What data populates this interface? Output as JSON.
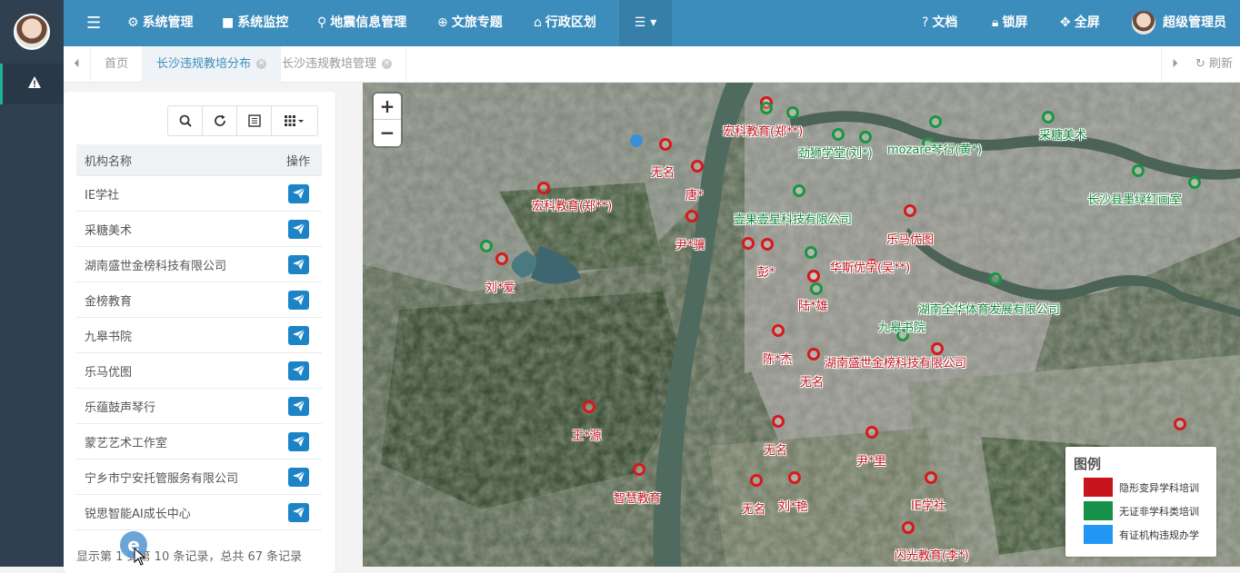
{
  "sidebar": {
    "avatar_alt": "avatar",
    "alert_icon": "warning-icon"
  },
  "navbar": {
    "menu_icon": "hamburger-icon",
    "items": [
      {
        "label": "系统管理",
        "icon": "gear-icon"
      },
      {
        "label": "系统监控",
        "icon": "video-icon"
      },
      {
        "label": "地震信息管理",
        "icon": "map-marker-icon"
      },
      {
        "label": "文旅专题",
        "icon": "globe-icon"
      },
      {
        "label": "行政区划",
        "icon": "bank-icon"
      }
    ],
    "more_icon": "list-dropdown-icon",
    "right": [
      {
        "label": "文档",
        "icon": "question-icon"
      },
      {
        "label": "锁屏",
        "icon": "lock-icon"
      },
      {
        "label": "全屏",
        "icon": "fullscreen-icon"
      }
    ],
    "user_name": "超级管理员"
  },
  "tabs": {
    "items": [
      {
        "label": "首页"
      },
      {
        "label": "长沙违规教培分布"
      },
      {
        "label": "长沙违规教培管理"
      }
    ],
    "refresh_label": "刷新"
  },
  "table": {
    "headers": {
      "name": "机构名称",
      "op": "操作"
    },
    "rows": [
      {
        "name": "IE学社"
      },
      {
        "name": "采糖美术"
      },
      {
        "name": "湖南盛世金榜科技有限公司"
      },
      {
        "name": "金榜教育"
      },
      {
        "name": "九皋书院"
      },
      {
        "name": "乐马优图"
      },
      {
        "name": "乐蕴鼓声琴行"
      },
      {
        "name": "蒙艺艺术工作室"
      },
      {
        "name": "宁乡市宁安托管服务有限公司"
      },
      {
        "name": "锐思智能AI成长中心"
      }
    ],
    "pager_text": "显示第 1 到第 10 条记录，总共 67 条记录"
  },
  "map": {
    "zoom_in": "+",
    "zoom_out": "−",
    "markers": [
      {
        "type": "red",
        "label": "宏科教育(郑**)"
      },
      {
        "type": "red",
        "label": "无名"
      },
      {
        "type": "red",
        "label": "唐*"
      },
      {
        "type": "red",
        "label": "宏科教育(郑**)"
      },
      {
        "type": "red",
        "label": "尹*骥"
      },
      {
        "type": "red",
        "label": "刘*爱"
      },
      {
        "type": "red",
        "label": "彭*"
      },
      {
        "type": "red",
        "label": "华斯优学(吴**)"
      },
      {
        "type": "red",
        "label": "乐马优图"
      },
      {
        "type": "red",
        "label": "陆*雄"
      },
      {
        "type": "red",
        "label": "陈*杰"
      },
      {
        "type": "red",
        "label": "湖南盛世金榜科技有限公司"
      },
      {
        "type": "red",
        "label": "无名"
      },
      {
        "type": "red",
        "label": "王*源"
      },
      {
        "type": "red",
        "label": "无名"
      },
      {
        "type": "red",
        "label": "尹*里"
      },
      {
        "type": "red",
        "label": "智慧教育"
      },
      {
        "type": "red",
        "label": "无名"
      },
      {
        "type": "red",
        "label": "刘*艳"
      },
      {
        "type": "red",
        "label": "IE学社"
      },
      {
        "type": "red",
        "label": "闪光教育(李*)"
      },
      {
        "type": "green",
        "label": "劲狮学堂(刘*)"
      },
      {
        "type": "green",
        "label": "mozare琴行(黄*)"
      },
      {
        "type": "green",
        "label": "采糖美术"
      },
      {
        "type": "green",
        "label": "长沙县墨绿红画室"
      },
      {
        "type": "green",
        "label": "壹果壹星科技有限公司"
      },
      {
        "type": "green",
        "label": "湖南全华体育发展有限公司"
      },
      {
        "type": "green",
        "label": "九皋书院"
      }
    ],
    "legend": {
      "title": "图例",
      "entries": [
        {
          "label": "隐形变异学科培训",
          "color": "#c8151b"
        },
        {
          "label": "无证非学科类培训",
          "color": "#17924a"
        },
        {
          "label": "有证机构违规办学",
          "color": "#2196f3"
        }
      ]
    }
  }
}
